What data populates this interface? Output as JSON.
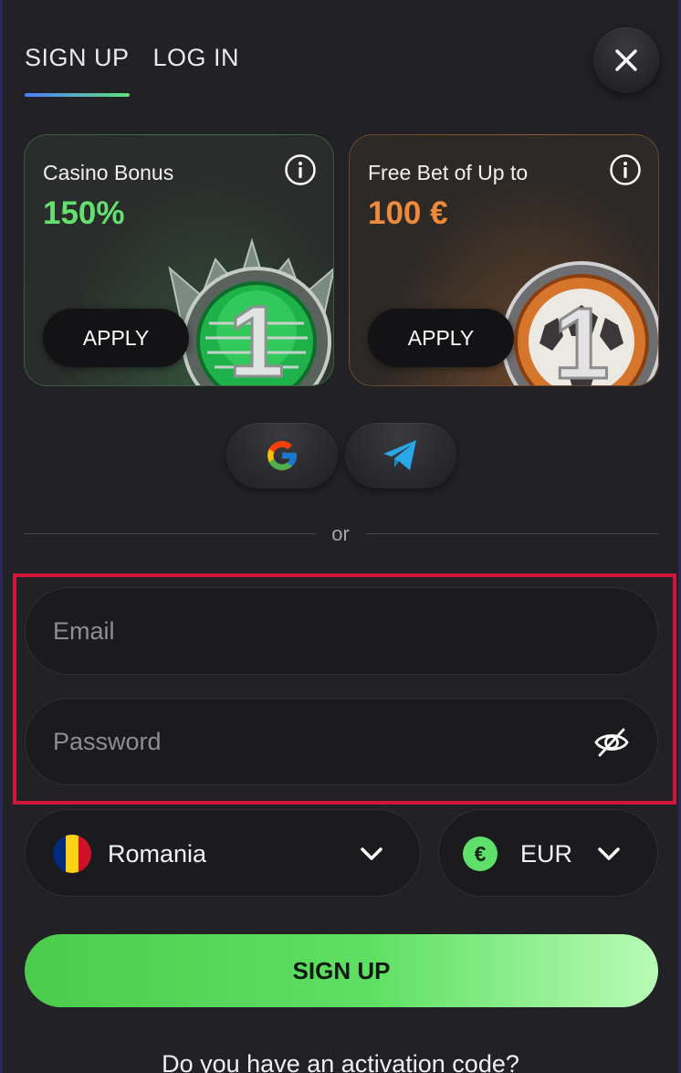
{
  "tabs": {
    "signup": "SIGN UP",
    "login": "LOG IN"
  },
  "bonuses": [
    {
      "title": "Casino Bonus",
      "amount": "150%",
      "apply_label": "APPLY",
      "medal_number": "1",
      "accent": "#64e06e"
    },
    {
      "title": "Free Bet of Up to",
      "amount": "100 €",
      "apply_label": "APPLY",
      "medal_number": "1",
      "accent": "#f08a3b"
    }
  ],
  "social": {
    "google": "google-icon",
    "telegram": "telegram-icon"
  },
  "divider": {
    "text": "or"
  },
  "form": {
    "email": {
      "placeholder": "Email",
      "value": ""
    },
    "password": {
      "placeholder": "Password",
      "value": ""
    }
  },
  "country": {
    "label": "Romania",
    "flag_colors": [
      "#002b7f",
      "#fcd116",
      "#ce1126"
    ]
  },
  "currency": {
    "label": "EUR",
    "symbol": "€"
  },
  "signup_button": "SIGN UP",
  "activation": "Do you have an activation code?",
  "colors": {
    "accent_green": "#5fe063",
    "highlight": "#d1163a",
    "background": "#222226"
  }
}
